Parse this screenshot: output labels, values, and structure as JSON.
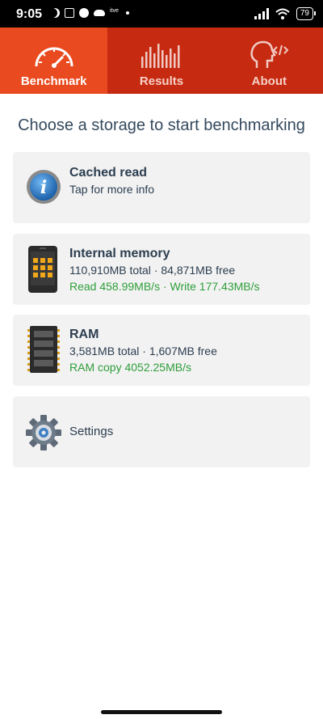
{
  "status_bar": {
    "time": "9:05",
    "tag": "itve",
    "battery": "79"
  },
  "tabs": [
    {
      "label": "Benchmark",
      "icon": "speedometer-icon",
      "active": true
    },
    {
      "label": "Results",
      "icon": "bars-icon",
      "active": false
    },
    {
      "label": "About",
      "icon": "head-code-icon",
      "active": false
    }
  ],
  "heading": "Choose a storage to start benchmarking",
  "cards": {
    "cached": {
      "title": "Cached read",
      "subtitle": "Tap for more info",
      "icon": "info-icon"
    },
    "internal": {
      "title": "Internal memory",
      "subtitle": "110,910MB total · 84,871MB free",
      "speed": "Read 458.99MB/s · Write 177.43MB/s",
      "icon": "phone-storage-icon"
    },
    "ram": {
      "title": "RAM",
      "subtitle": "3,581MB total · 1,607MB free",
      "speed": "RAM copy 4052.25MB/s",
      "icon": "ram-chip-icon"
    },
    "settings": {
      "title": "Settings",
      "icon": "gear-icon"
    }
  },
  "colors": {
    "tabbar": "#c62a10",
    "tab_active": "#e94a1f",
    "speed_text": "#2e9e3a",
    "card_bg": "#f2f2f2"
  }
}
